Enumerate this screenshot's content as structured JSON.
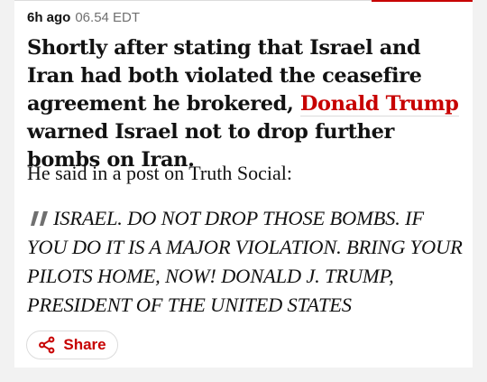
{
  "entry": {
    "time_ago": "6h ago",
    "timestamp": "06.54 EDT",
    "headline_before": "Shortly after stating that Israel and Iran had both violated the ceasefire agreement he brokered, ",
    "headline_link": "Donald Trump",
    "headline_after": " warned Israel not to drop further bombs on Iran.",
    "paragraph": "He said in a post on Truth Social:",
    "quote": "ISRAEL. DO NOT DROP THOSE BOMBS. IF YOU DO IT IS A MAJOR VIOLATION. BRING YOUR PILOTS HOME, NOW! DONALD J. TRUMP, PRESIDENT OF THE UNITED STATES",
    "quote_icon": "quote-mark-icon",
    "share_label": "Share",
    "share_icon": "share-icon"
  },
  "colors": {
    "accent": "#c70000",
    "text": "#121212",
    "muted": "#707070",
    "background": "#ffffff",
    "page_background": "#f2f2f2"
  }
}
